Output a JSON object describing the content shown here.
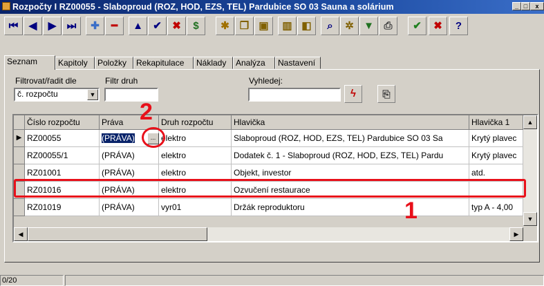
{
  "window": {
    "title": "Rozpočty I RZ00055 - Slaboproud (ROZ, HOD, EZS, TEL) Pardubice  SO 03 Sauna a solárium",
    "controls": [
      "_",
      "□",
      "x"
    ]
  },
  "toolbar": [
    {
      "icon": "first-record-icon",
      "glyph": "⏮",
      "color": "#000080"
    },
    {
      "icon": "prev-record-icon",
      "glyph": "◀",
      "color": "#000080"
    },
    {
      "icon": "next-record-icon",
      "glyph": "▶",
      "color": "#000080"
    },
    {
      "icon": "last-record-icon",
      "glyph": "⏭",
      "color": "#000080"
    },
    {
      "icon": "add-record-icon",
      "glyph": "✚",
      "color": "#3a6ec8"
    },
    {
      "icon": "delete-record-icon",
      "glyph": "━",
      "color": "#c00000"
    },
    {
      "icon": "edit-up-icon",
      "glyph": "▲",
      "color": "#000080"
    },
    {
      "icon": "confirm-icon",
      "glyph": "✔",
      "color": "#000080"
    },
    {
      "icon": "cancel-icon",
      "glyph": "✖",
      "color": "#c00000"
    },
    {
      "icon": "refresh-icon",
      "glyph": "$",
      "color": "#207020"
    },
    {
      "icon": "pin-icon",
      "glyph": "✱",
      "color": "#a07000"
    },
    {
      "icon": "copy-icon",
      "glyph": "❐",
      "color": "#806000"
    },
    {
      "icon": "paste-icon",
      "glyph": "▣",
      "color": "#806000"
    },
    {
      "icon": "book-icon",
      "glyph": "▥",
      "color": "#806000"
    },
    {
      "icon": "tree-icon",
      "glyph": "◧",
      "color": "#806000"
    },
    {
      "icon": "find-icon",
      "glyph": "⌕",
      "color": "#000080"
    },
    {
      "icon": "settings-icon",
      "glyph": "✲",
      "color": "#806000"
    },
    {
      "icon": "filter-icon",
      "glyph": "▼",
      "color": "#207020"
    },
    {
      "icon": "print-icon",
      "glyph": "⎙",
      "color": "#404040"
    },
    {
      "icon": "ok-icon",
      "glyph": "✔",
      "color": "#208020"
    },
    {
      "icon": "close-icon",
      "glyph": "✖",
      "color": "#c00000"
    },
    {
      "icon": "help-icon",
      "glyph": "?",
      "color": "#000080"
    }
  ],
  "tabs": [
    "Seznam",
    "Kapitoly",
    "Položky",
    "Rekapitulace",
    "Náklady",
    "Analýza",
    "Nastavení"
  ],
  "filters": {
    "sort_label": "Filtrovat/řadit dle",
    "sort_value": "č. rozpočtu",
    "type_label": "Filtr druh",
    "type_value": "",
    "search_label": "Vyhledej:",
    "search_value": ""
  },
  "grid": {
    "columns": [
      "Číslo rozpočtu",
      "Práva",
      "Druh rozpočtu",
      "Hlavička",
      "Hlavička 1"
    ],
    "rows": [
      [
        "RZ00055",
        "(PRÁVA)",
        "elektro",
        "Slaboproud (ROZ, HOD, EZS, TEL) Pardubice  SO 03 Sa",
        "Krytý plavec"
      ],
      [
        "RZ00055/1",
        "(PRÁVA)",
        "elektro",
        "Dodatek č. 1 - Slaboproud (ROZ, HOD, EZS, TEL) Pardu",
        "Krytý plavec"
      ],
      [
        "RZ01001",
        "(PRÁVA)",
        "elektro",
        "Objekt, investor",
        "atd."
      ],
      [
        "RZ01016",
        "(PRÁVA)",
        "elektro",
        "Ozvučení restaurace",
        ""
      ],
      [
        "RZ01019",
        "(PRÁVA)",
        "vyr01",
        "Držák reproduktoru",
        "typ A - 4,00"
      ]
    ],
    "ellipsis": "..."
  },
  "status": {
    "record": "0/20"
  },
  "annotations": {
    "one": "1",
    "two": "2"
  }
}
